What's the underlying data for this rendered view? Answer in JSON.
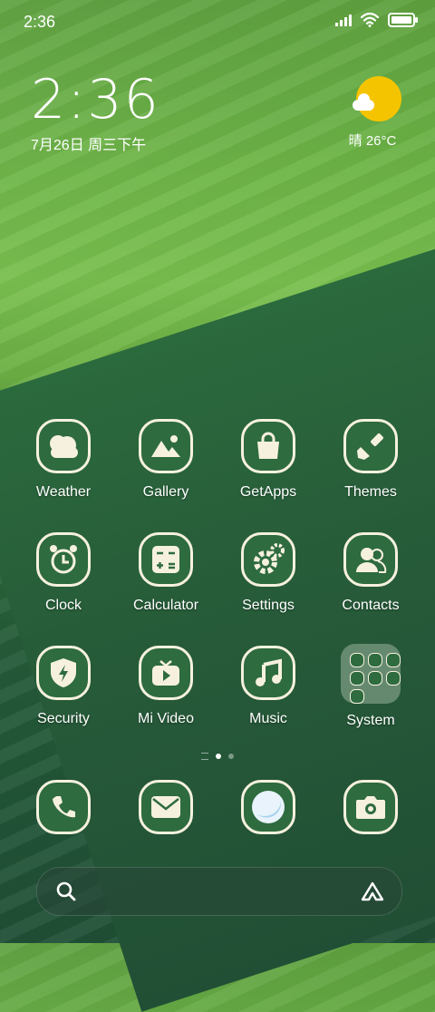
{
  "status_bar": {
    "time": "2:36"
  },
  "clock_widget": {
    "time": "2:36",
    "date": "7月26日 周三下午"
  },
  "weather_widget": {
    "condition": "晴",
    "temperature": "26°C"
  },
  "apps": [
    {
      "label": "Weather",
      "icon": "weather-icon"
    },
    {
      "label": "Gallery",
      "icon": "gallery-icon"
    },
    {
      "label": "GetApps",
      "icon": "shopping-bag-icon"
    },
    {
      "label": "Themes",
      "icon": "paintbrush-icon"
    },
    {
      "label": "Clock",
      "icon": "alarm-clock-icon"
    },
    {
      "label": "Calculator",
      "icon": "calculator-icon"
    },
    {
      "label": "Settings",
      "icon": "gear-icon"
    },
    {
      "label": "Contacts",
      "icon": "contacts-icon"
    },
    {
      "label": "Security",
      "icon": "shield-icon"
    },
    {
      "label": "Mi Video",
      "icon": "video-play-icon"
    },
    {
      "label": "Music",
      "icon": "music-note-icon"
    },
    {
      "label": "System",
      "icon": "folder-icon"
    }
  ],
  "dock": [
    {
      "icon": "phone-icon"
    },
    {
      "icon": "message-icon"
    },
    {
      "icon": "browser-icon"
    },
    {
      "icon": "camera-icon"
    }
  ],
  "page_indicator": {
    "pages": 2,
    "active": 1
  },
  "colors": {
    "icon_bg": "#2e6b3f",
    "icon_fg": "#f6f1de",
    "sun": "#f5c400"
  }
}
